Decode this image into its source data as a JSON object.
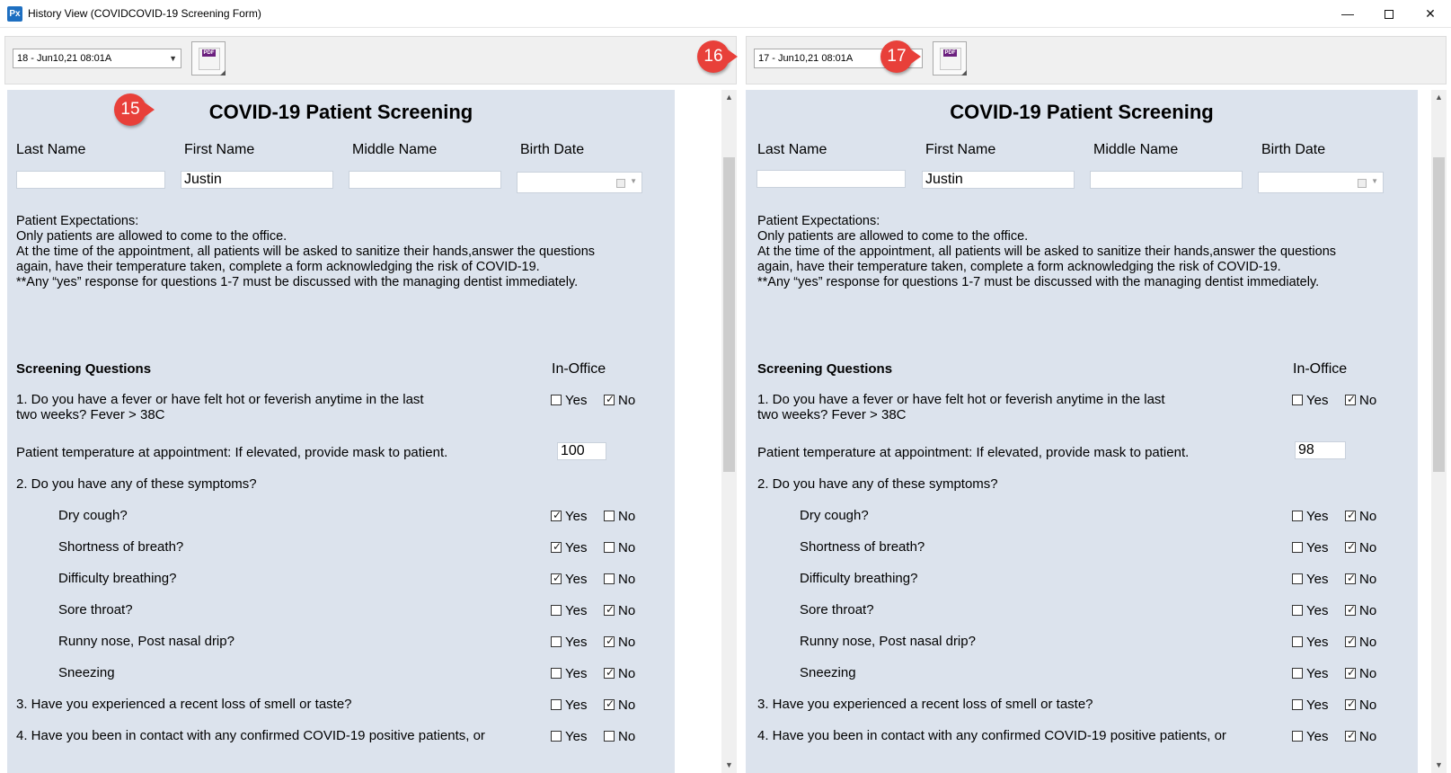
{
  "window": {
    "title": "History View (COVIDCOVID-19 Screening Form)",
    "icon_text": "Px"
  },
  "left": {
    "combo_value": "18 - Jun10,21 08:01A",
    "pdf_label": "PDF",
    "callout": "15",
    "temperature": "100",
    "checks": {
      "q1": "no",
      "cough": "yes",
      "breath_short": "yes",
      "breathing": "yes",
      "sore": "no",
      "runny": "no",
      "sneeze": "no",
      "q3": "no",
      "q4": "none"
    }
  },
  "right": {
    "combo_value": "17 - Jun10,21 08:01A",
    "pdf_label": "PDF",
    "callout_combo": "16",
    "callout_pdf": "17",
    "temperature": "98",
    "checks": {
      "q1": "no",
      "cough": "no",
      "breath_short": "no",
      "breathing": "no",
      "sore": "no",
      "runny": "no",
      "sneeze": "no",
      "q3": "no",
      "q4": "no"
    }
  },
  "form": {
    "title": "COVID-19 Patient Screening",
    "last_name_label": "Last Name",
    "first_name_label": "First Name",
    "middle_name_label": "Middle Name",
    "birth_date_label": "Birth Date",
    "first_name_value": "Justin",
    "expectations": "Patient Expectations:\nOnly patients are allowed to come to the office.\nAt the time of the appointment, all patients will be asked to sanitize their hands,answer the questions\nagain, have their temperature taken, complete a form acknowledging the risk of COVID-19.\n**Any “yes” response for questions 1-7 must be discussed with the managing dentist immediately.",
    "screening_header": "Screening Questions",
    "in_office_header": "In-Office",
    "q1": "1. Do you have a fever or have felt hot or feverish anytime in the last\ntwo weeks? Fever > 38C",
    "temp_label": "Patient temperature at appointment: If elevated, provide mask to patient.",
    "q2": "2. Do you have any of these symptoms?",
    "s_cough": "Dry cough?",
    "s_breath_short": "Shortness of breath?",
    "s_breathing": "Difficulty breathing?",
    "s_sore": "Sore throat?",
    "s_runny": "Runny nose, Post nasal drip?",
    "s_sneeze": "Sneezing",
    "q3": "3. Have you experienced a recent loss of smell or taste?",
    "q4": "4. Have you been in contact with any confirmed COVID-19 positive patients, or",
    "yes": "Yes",
    "no": "No"
  }
}
